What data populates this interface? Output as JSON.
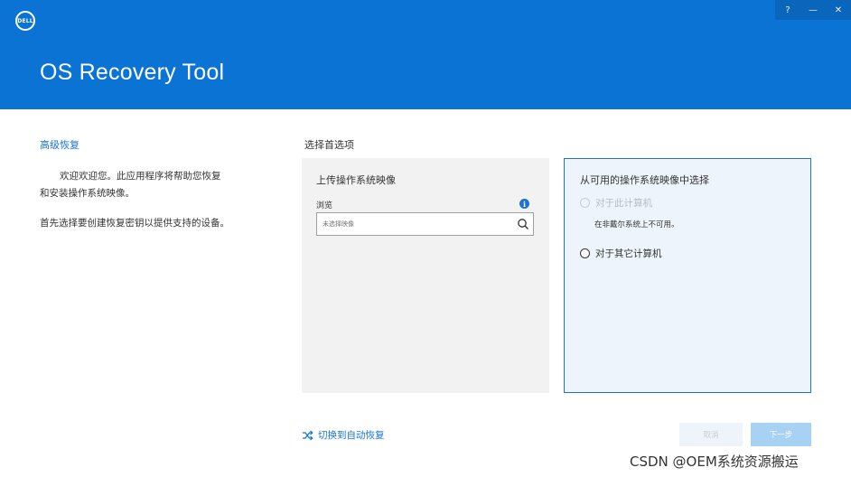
{
  "header": {
    "logo_text": "DELL",
    "title": "OS Recovery Tool",
    "window_controls": {
      "help": "?",
      "minimize": "—",
      "close": "✕"
    }
  },
  "sidebar": {
    "title": "高级恢复",
    "welcome": "欢迎欢迎您。此应用程序将帮助您恢复和安装操作系统映像。",
    "instruction": "首先选择要创建恢复密钥以提供支持的设备。"
  },
  "main": {
    "section_title": "选择首选项",
    "upload_panel": {
      "title": "上传操作系统映像",
      "browse_label": "浏览",
      "search_placeholder": "未选择映像"
    },
    "choose_panel": {
      "title": "从可用的操作系统映像中选择",
      "option_this_computer": "对于此计算机",
      "option_this_computer_note": "在非戴尔系统上不可用。",
      "option_other_computer": "对于其它计算机"
    },
    "switch_link": "切换到自动恢复"
  },
  "footer": {
    "cancel_label": "取消",
    "next_label": "下一步"
  },
  "watermark": "CSDN @OEM系统资源搬运",
  "colors": {
    "header_bg": "#0b73d3",
    "accent": "#1a73d4",
    "panel_bg": "#f2f2f2",
    "selected_panel_bg": "#eef4fb"
  }
}
